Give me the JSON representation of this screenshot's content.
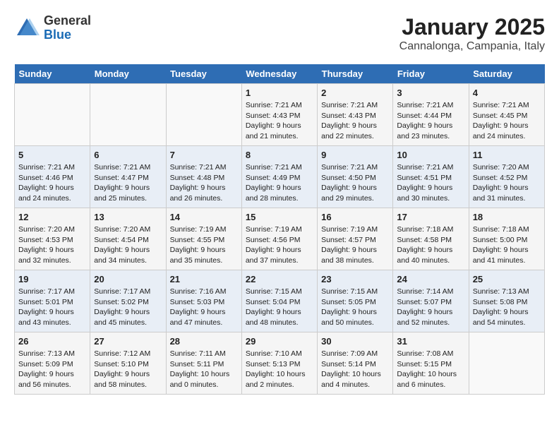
{
  "logo": {
    "general": "General",
    "blue": "Blue"
  },
  "title": "January 2025",
  "subtitle": "Cannalonga, Campania, Italy",
  "weekdays": [
    "Sunday",
    "Monday",
    "Tuesday",
    "Wednesday",
    "Thursday",
    "Friday",
    "Saturday"
  ],
  "weeks": [
    [
      {
        "day": "",
        "content": ""
      },
      {
        "day": "",
        "content": ""
      },
      {
        "day": "",
        "content": ""
      },
      {
        "day": "1",
        "content": "Sunrise: 7:21 AM\nSunset: 4:43 PM\nDaylight: 9 hours\nand 21 minutes."
      },
      {
        "day": "2",
        "content": "Sunrise: 7:21 AM\nSunset: 4:43 PM\nDaylight: 9 hours\nand 22 minutes."
      },
      {
        "day": "3",
        "content": "Sunrise: 7:21 AM\nSunset: 4:44 PM\nDaylight: 9 hours\nand 23 minutes."
      },
      {
        "day": "4",
        "content": "Sunrise: 7:21 AM\nSunset: 4:45 PM\nDaylight: 9 hours\nand 24 minutes."
      }
    ],
    [
      {
        "day": "5",
        "content": "Sunrise: 7:21 AM\nSunset: 4:46 PM\nDaylight: 9 hours\nand 24 minutes."
      },
      {
        "day": "6",
        "content": "Sunrise: 7:21 AM\nSunset: 4:47 PM\nDaylight: 9 hours\nand 25 minutes."
      },
      {
        "day": "7",
        "content": "Sunrise: 7:21 AM\nSunset: 4:48 PM\nDaylight: 9 hours\nand 26 minutes."
      },
      {
        "day": "8",
        "content": "Sunrise: 7:21 AM\nSunset: 4:49 PM\nDaylight: 9 hours\nand 28 minutes."
      },
      {
        "day": "9",
        "content": "Sunrise: 7:21 AM\nSunset: 4:50 PM\nDaylight: 9 hours\nand 29 minutes."
      },
      {
        "day": "10",
        "content": "Sunrise: 7:21 AM\nSunset: 4:51 PM\nDaylight: 9 hours\nand 30 minutes."
      },
      {
        "day": "11",
        "content": "Sunrise: 7:20 AM\nSunset: 4:52 PM\nDaylight: 9 hours\nand 31 minutes."
      }
    ],
    [
      {
        "day": "12",
        "content": "Sunrise: 7:20 AM\nSunset: 4:53 PM\nDaylight: 9 hours\nand 32 minutes."
      },
      {
        "day": "13",
        "content": "Sunrise: 7:20 AM\nSunset: 4:54 PM\nDaylight: 9 hours\nand 34 minutes."
      },
      {
        "day": "14",
        "content": "Sunrise: 7:19 AM\nSunset: 4:55 PM\nDaylight: 9 hours\nand 35 minutes."
      },
      {
        "day": "15",
        "content": "Sunrise: 7:19 AM\nSunset: 4:56 PM\nDaylight: 9 hours\nand 37 minutes."
      },
      {
        "day": "16",
        "content": "Sunrise: 7:19 AM\nSunset: 4:57 PM\nDaylight: 9 hours\nand 38 minutes."
      },
      {
        "day": "17",
        "content": "Sunrise: 7:18 AM\nSunset: 4:58 PM\nDaylight: 9 hours\nand 40 minutes."
      },
      {
        "day": "18",
        "content": "Sunrise: 7:18 AM\nSunset: 5:00 PM\nDaylight: 9 hours\nand 41 minutes."
      }
    ],
    [
      {
        "day": "19",
        "content": "Sunrise: 7:17 AM\nSunset: 5:01 PM\nDaylight: 9 hours\nand 43 minutes."
      },
      {
        "day": "20",
        "content": "Sunrise: 7:17 AM\nSunset: 5:02 PM\nDaylight: 9 hours\nand 45 minutes."
      },
      {
        "day": "21",
        "content": "Sunrise: 7:16 AM\nSunset: 5:03 PM\nDaylight: 9 hours\nand 47 minutes."
      },
      {
        "day": "22",
        "content": "Sunrise: 7:15 AM\nSunset: 5:04 PM\nDaylight: 9 hours\nand 48 minutes."
      },
      {
        "day": "23",
        "content": "Sunrise: 7:15 AM\nSunset: 5:05 PM\nDaylight: 9 hours\nand 50 minutes."
      },
      {
        "day": "24",
        "content": "Sunrise: 7:14 AM\nSunset: 5:07 PM\nDaylight: 9 hours\nand 52 minutes."
      },
      {
        "day": "25",
        "content": "Sunrise: 7:13 AM\nSunset: 5:08 PM\nDaylight: 9 hours\nand 54 minutes."
      }
    ],
    [
      {
        "day": "26",
        "content": "Sunrise: 7:13 AM\nSunset: 5:09 PM\nDaylight: 9 hours\nand 56 minutes."
      },
      {
        "day": "27",
        "content": "Sunrise: 7:12 AM\nSunset: 5:10 PM\nDaylight: 9 hours\nand 58 minutes."
      },
      {
        "day": "28",
        "content": "Sunrise: 7:11 AM\nSunset: 5:11 PM\nDaylight: 10 hours\nand 0 minutes."
      },
      {
        "day": "29",
        "content": "Sunrise: 7:10 AM\nSunset: 5:13 PM\nDaylight: 10 hours\nand 2 minutes."
      },
      {
        "day": "30",
        "content": "Sunrise: 7:09 AM\nSunset: 5:14 PM\nDaylight: 10 hours\nand 4 minutes."
      },
      {
        "day": "31",
        "content": "Sunrise: 7:08 AM\nSunset: 5:15 PM\nDaylight: 10 hours\nand 6 minutes."
      },
      {
        "day": "",
        "content": ""
      }
    ]
  ]
}
